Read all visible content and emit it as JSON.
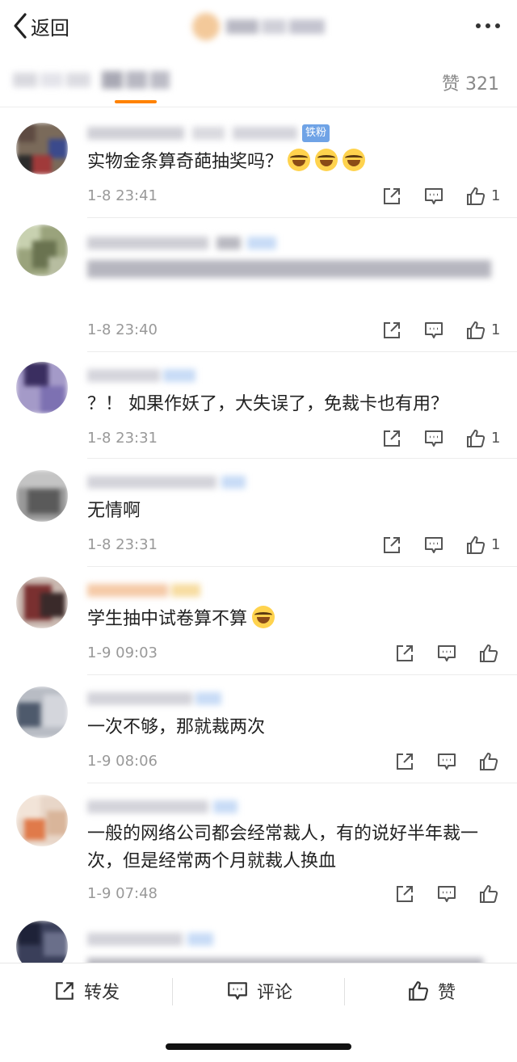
{
  "header": {
    "back_label": "返回"
  },
  "tabbar": {
    "like_count": "赞 321"
  },
  "comments": [
    {
      "badge": "铁粉",
      "text": "实物金条算奇葩抽奖吗？",
      "time": "1-8 23:41",
      "likes": "1"
    },
    {
      "text": "",
      "time": "1-8 23:40",
      "likes": "1"
    },
    {
      "text": "？！ 如果作妖了，大失误了，免裁卡也有用？",
      "time": "1-8 23:31",
      "likes": "1"
    },
    {
      "text": "无情啊",
      "time": "1-8 23:31",
      "likes": "1"
    },
    {
      "text": "学生抽中试卷算不算",
      "time": "1-9 09:03",
      "likes": ""
    },
    {
      "text": "一次不够，那就裁两次",
      "time": "1-9 08:06",
      "likes": ""
    },
    {
      "text": "一般的网络公司都会经常裁人，有的说好半年裁一次，但是经常两个月就裁人换血",
      "time": "1-9 07:48",
      "likes": ""
    }
  ],
  "bottombar": {
    "repost": "转发",
    "comment": "评论",
    "like": "赞"
  },
  "colors": {
    "accent": "#ff8200",
    "badge": "#6fa3e6",
    "muted": "#999999"
  }
}
